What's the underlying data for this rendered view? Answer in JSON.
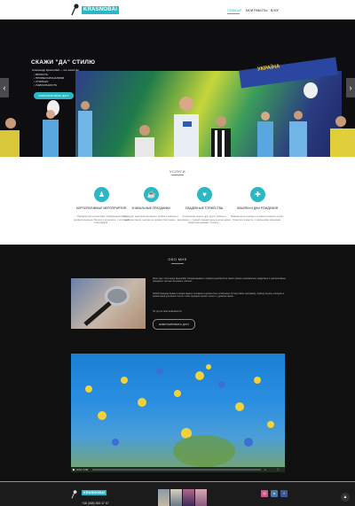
{
  "header": {
    "logo_text": "KRASNOBAI",
    "nav": [
      "ГЛАВНАЯ",
      "МОИ РАБОТЫ",
      "ВЛОГ"
    ]
  },
  "hero": {
    "title": "СКАЖИ \"ДА\" СТИЛЮ",
    "intro": "Александр Краснобай — это качество",
    "bullets": [
      "• ЯРКОСТЬ",
      "• ПРОФЕССИОНАЛИЗМ",
      "• СТИЛЬНО",
      "• УНИКАЛЬНОСТЬ"
    ],
    "button": "ЗАБРОНИРОВАТЬ ДАТУ",
    "banner_text": "УКРАЇНА",
    "prev": "‹",
    "next": "›"
  },
  "services": {
    "title": "УСЛУГИ",
    "items": [
      {
        "icon": "person-icon",
        "glyph": "♟",
        "title": "КОРПОРАТИВНЫЕ МЕРОПРИЯТИЯ",
        "text": "... Праздник для коллектива, проведенный ярко и профессионально. Весело и интересно, с отличной атмосферой."
      },
      {
        "icon": "cup-icon",
        "glyph": "☕",
        "title": "УНИКАЛЬНЫЕ ПРАЗДНИКИ",
        "text": "Праздник, мероприятие вашего уровня с юмором и удовольствием, никогда не пройдет бесследно..."
      },
      {
        "icon": "heart-icon",
        "glyph": "♥",
        "title": "СВАДЕБНЫЕ ТОРЖЕСТВА",
        "text": "Стремление понять друг друга, помочь и вдохновить... Самый главный день в жизни двоих людей заслуживает лучшего..."
      },
      {
        "icon": "gift-icon",
        "glyph": "✚",
        "title": "ЮБИЛЕИ И ДНИ РОЖДЕНИЯ",
        "text": "Важные даты в жизни и в памяти каждого из нас. Отметим их вместе, с искренними эмоциями..."
      }
    ]
  },
  "about": {
    "title": "ОБО МНЕ",
    "paragraph1": "Меня зовут Александр Краснобай. Организовываю и провожу мероприятия самого разного направления, свадебные и корпоративные праздники, частные вечеринки, юбилеи...",
    "paragraph2": "Любой праздник бывает в жизни каждого человека и должен быть особенным. Я подготовлю программу, подберу музыку, конкурсы и развлечения для ваших гостей, чтобы праздник прошёл легко и с удовольствием...",
    "paragraph3": "Не упусти свою возможность!",
    "button": "ЗАБРОНИРОВАТЬ ДАТУ"
  },
  "video": {
    "time": "0:00 / 2:59"
  },
  "footer": {
    "logo_text": "KRASNOBAI",
    "phone": "+38 (068) 358 47 67",
    "social": [
      {
        "name": "instagram-icon",
        "glyph": "◎",
        "color": "#c85a8a"
      },
      {
        "name": "vk-icon",
        "glyph": "в",
        "color": "#4a76a8"
      },
      {
        "name": "facebook-icon",
        "glyph": "f",
        "color": "#3b5998"
      }
    ],
    "scroll_top": "▲"
  },
  "colors": {
    "accent": "#2bb8c4",
    "dark": "#101010"
  }
}
